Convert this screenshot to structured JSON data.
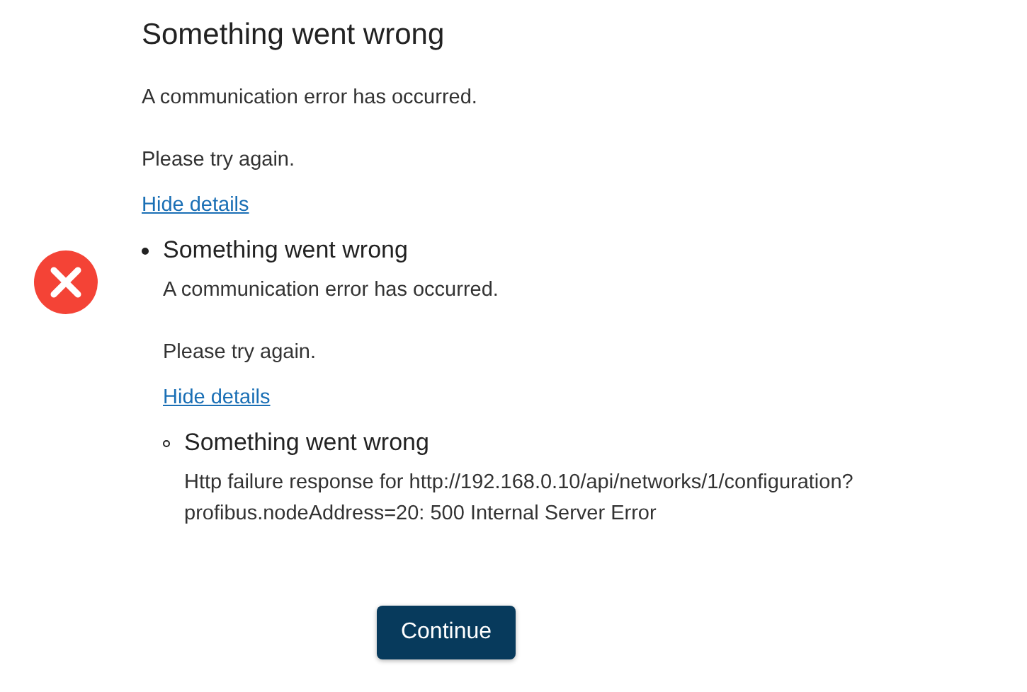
{
  "error": {
    "title": "Something went wrong",
    "message": "A communication error has occurred.",
    "hint": "Please try again.",
    "details_link": "Hide details",
    "details": {
      "title": "Something went wrong",
      "message": "A communication error has occurred.",
      "hint": "Please try again.",
      "details_link": "Hide details",
      "details": {
        "title": "Something went wrong",
        "message": "Http failure response for http://192.168.0.10/api/networks/1/configuration?\nprofibus.nodeAddress=20: 500 Internal Server Error"
      }
    }
  },
  "button": "Continue"
}
